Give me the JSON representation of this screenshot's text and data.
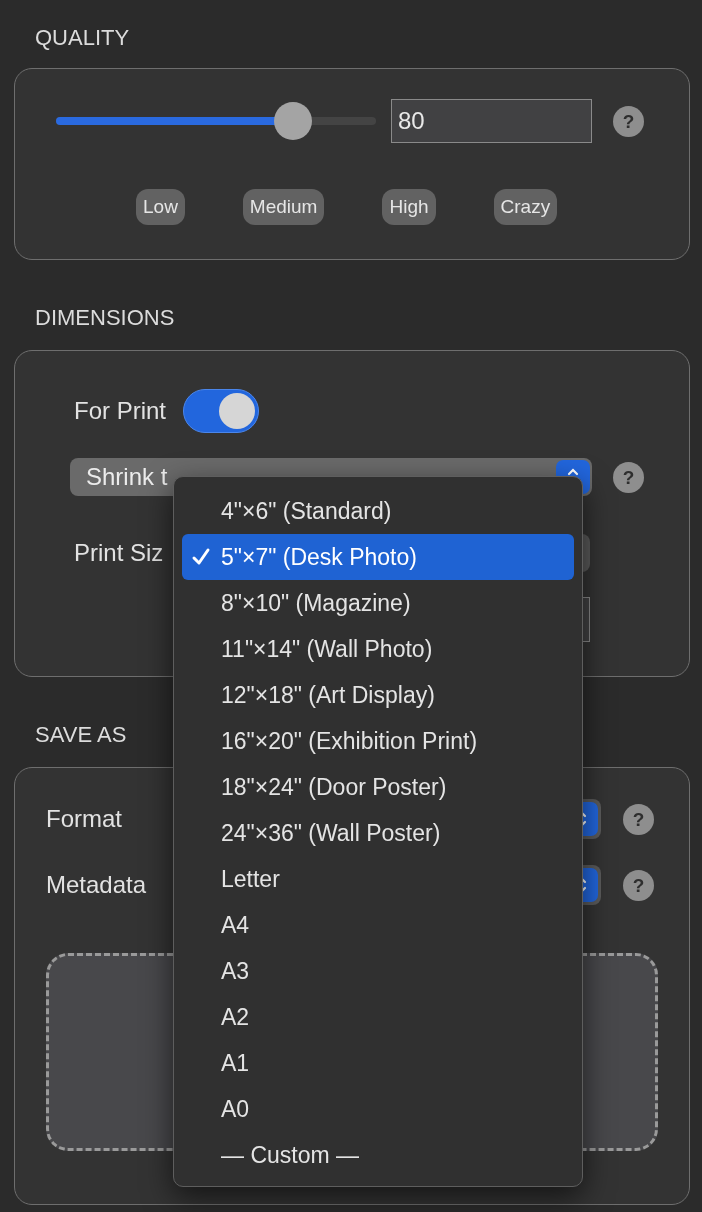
{
  "quality": {
    "title": "QUALITY",
    "slider": {
      "level": 0.74
    },
    "value": "80",
    "help": "?",
    "presets": [
      {
        "label": "Low"
      },
      {
        "label": "Medium"
      },
      {
        "label": "High"
      },
      {
        "label": "Crazy"
      }
    ]
  },
  "dimensions": {
    "title": "DIMENSIONS",
    "for_print": {
      "label": "For Print",
      "on": true
    },
    "fit_mode": {
      "value": "Shrink t",
      "help": "?"
    },
    "print_size": {
      "label": "Print Siz"
    }
  },
  "save_as": {
    "title": "SAVE AS",
    "format": {
      "label": "Format",
      "help": "?"
    },
    "metadata": {
      "label": "Metadata",
      "help": "?"
    }
  },
  "menu": {
    "items": [
      {
        "label": "4\"×6\" (Standard)",
        "selected": false
      },
      {
        "label": "5\"×7\" (Desk Photo)",
        "selected": true
      },
      {
        "label": "8\"×10\" (Magazine)",
        "selected": false
      },
      {
        "label": "11\"×14\" (Wall Photo)",
        "selected": false
      },
      {
        "label": "12\"×18\" (Art Display)",
        "selected": false
      },
      {
        "label": "16\"×20\" (Exhibition Print)",
        "selected": false
      },
      {
        "label": "18\"×24\" (Door Poster)",
        "selected": false
      },
      {
        "label": "24\"×36\" (Wall Poster)",
        "selected": false
      },
      {
        "label": "Letter",
        "selected": false
      },
      {
        "label": "A4",
        "selected": false
      },
      {
        "label": "A3",
        "selected": false
      },
      {
        "label": "A2",
        "selected": false
      },
      {
        "label": "A1",
        "selected": false
      },
      {
        "label": "A0",
        "selected": false
      },
      {
        "label": "— Custom —",
        "selected": false
      }
    ]
  }
}
